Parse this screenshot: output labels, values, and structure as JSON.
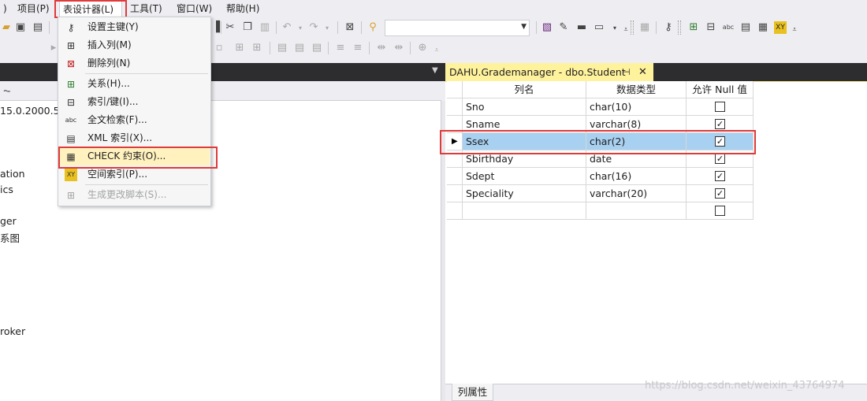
{
  "menubar": {
    "items": [
      {
        "label": ")"
      },
      {
        "label": "项目(P)"
      },
      {
        "label": "表设计器(L)"
      },
      {
        "label": "工具(T)"
      },
      {
        "label": "窗口(W)"
      },
      {
        "label": "帮助(H)"
      }
    ]
  },
  "dropdown": {
    "items": [
      {
        "label": "设置主键(Y)",
        "icon": "key-icon"
      },
      {
        "label": "插入列(M)",
        "icon": "insert-column-icon"
      },
      {
        "label": "删除列(N)",
        "icon": "delete-column-icon"
      },
      {
        "label": "关系(H)...",
        "icon": "relationship-icon"
      },
      {
        "label": "索引/键(I)...",
        "icon": "index-icon"
      },
      {
        "label": "全文检索(F)...",
        "icon": "fulltext-icon"
      },
      {
        "label": "XML 索引(X)...",
        "icon": "xml-index-icon"
      },
      {
        "label": "CHECK 约束(O)...",
        "icon": "check-constraint-icon"
      },
      {
        "label": "空间索引(P)...",
        "icon": "spatial-index-icon"
      },
      {
        "label": "生成更改脚本(S)...",
        "icon": "generate-script-icon"
      }
    ]
  },
  "left_panel": {
    "lines": [
      "15.0.2000.5 -",
      "ation",
      "ics",
      "ger",
      "系图",
      "roker"
    ]
  },
  "tab": {
    "title": "DAHU.Grademanager - dbo.Student",
    "pin": "⊣",
    "close": "✕"
  },
  "grid": {
    "headers": [
      "列名",
      "数据类型",
      "允许 Null 值"
    ],
    "rows": [
      {
        "name": "Sno",
        "type": "char(10)",
        "allow_null": false
      },
      {
        "name": "Sname",
        "type": "varchar(8)",
        "allow_null": true
      },
      {
        "name": "Ssex",
        "type": "char(2)",
        "allow_null": true,
        "selected": true
      },
      {
        "name": "Sbirthday",
        "type": "date",
        "allow_null": true
      },
      {
        "name": "Sdept",
        "type": "char(16)",
        "allow_null": true
      },
      {
        "name": "Speciality",
        "type": "varchar(20)",
        "allow_null": true
      },
      {
        "name": "",
        "type": "",
        "allow_null": false
      }
    ]
  },
  "bottom": {
    "props_tab": "列属性",
    "watermark": "https://blog.csdn.net/weixin_43764974"
  },
  "colors": {
    "highlight_red": "#e03a3a",
    "tab_yellow": "#fff29d",
    "selected_row": "#a8d0f0",
    "menu_highlight": "#fff2bf"
  }
}
